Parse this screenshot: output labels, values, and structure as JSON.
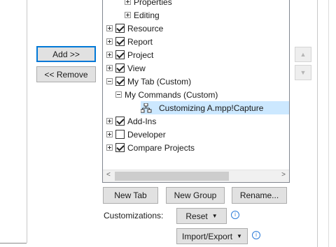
{
  "left_buttons": {
    "add": "Add >>",
    "remove": "<< Remove"
  },
  "tree": {
    "items": [
      {
        "label": "Properties",
        "expander": "plus",
        "checkbox": "none",
        "indent": 2
      },
      {
        "label": "Editing",
        "expander": "plus",
        "checkbox": "none",
        "indent": 2
      },
      {
        "label": "Resource",
        "expander": "plus",
        "checkbox": "checked",
        "indent": 0
      },
      {
        "label": "Report",
        "expander": "plus",
        "checkbox": "checked",
        "indent": 0
      },
      {
        "label": "Project",
        "expander": "plus",
        "checkbox": "checked",
        "indent": 0
      },
      {
        "label": "View",
        "expander": "plus",
        "checkbox": "checked",
        "indent": 0
      },
      {
        "label": "My Tab (Custom)",
        "expander": "minus",
        "checkbox": "checked",
        "indent": 0
      },
      {
        "label": "My Commands (Custom)",
        "expander": "minus",
        "checkbox": "none",
        "indent": 1
      },
      {
        "label": "Customizing A.mpp!Capture",
        "expander": "none",
        "checkbox": "none",
        "indent": 2,
        "selected": true,
        "icon": "command-icon"
      },
      {
        "label": "Add-Ins",
        "expander": "plus",
        "checkbox": "checked",
        "indent": 0
      },
      {
        "label": "Developer",
        "expander": "plus",
        "checkbox": "unchecked",
        "indent": 0
      },
      {
        "label": "Compare Projects",
        "expander": "plus",
        "checkbox": "checked",
        "indent": 0
      }
    ],
    "scroll_left_glyph": "<",
    "scroll_right_glyph": ">"
  },
  "move_buttons": {
    "up_icon": "triangle-up-icon",
    "down_icon": "triangle-down-icon",
    "up_glyph": "▲",
    "down_glyph": "▼"
  },
  "bottom_buttons": {
    "new_tab": "New Tab",
    "new_group": "New Group",
    "rename": "Rename..."
  },
  "customizations": {
    "label": "Customizations:",
    "reset": "Reset",
    "import_export": "Import/Export",
    "dropdown_glyph": "▼",
    "info_glyph": "i"
  },
  "colors": {
    "selection": "#cce8ff",
    "accent": "#0078d7",
    "info": "#2b7bd8"
  }
}
